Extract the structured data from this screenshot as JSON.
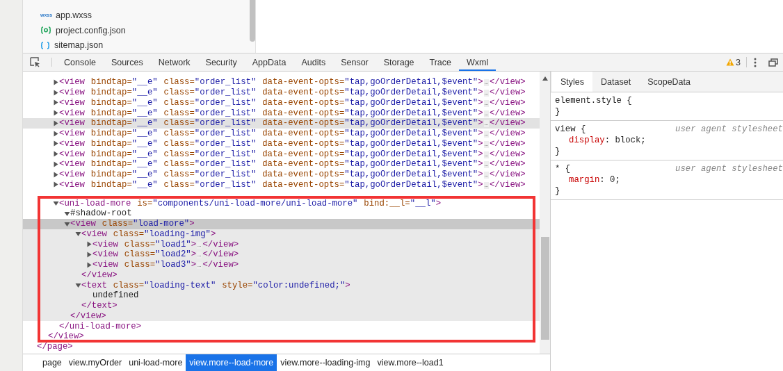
{
  "file_tree": {
    "items": [
      {
        "name": "app.wxss",
        "kind": "wxss",
        "badge": "wxss"
      },
      {
        "name": "project.config.json",
        "kind": "config"
      },
      {
        "name": "sitemap.json",
        "kind": "json"
      }
    ]
  },
  "toolbar": {
    "tabs": [
      {
        "label": "Console",
        "selected": false
      },
      {
        "label": "Sources",
        "selected": false
      },
      {
        "label": "Network",
        "selected": false
      },
      {
        "label": "Security",
        "selected": false
      },
      {
        "label": "AppData",
        "selected": false
      },
      {
        "label": "Audits",
        "selected": false
      },
      {
        "label": "Sensor",
        "selected": false
      },
      {
        "label": "Storage",
        "selected": false
      },
      {
        "label": "Trace",
        "selected": false
      },
      {
        "label": "Wxml",
        "selected": true
      }
    ],
    "warnings": "3"
  },
  "elements": {
    "tree": [
      {
        "close": "</page>",
        "children": [
          {
            "close": "</view>",
            "children": [
              {
                "open": {
                  "tag": "<view",
                  "attrs": [
                    {
                      "name": "bindtap=",
                      "value": "\"__e\""
                    },
                    {
                      "name": "class=",
                      "value": "\"order_list\""
                    },
                    {
                      "name": "data-event-opts=",
                      "value": "\"tap,goOrderDetail,$event\""
                    }
                  ],
                  "end": ">"
                },
                "expanded": false,
                "hovered": false,
                "ellipsis": "…",
                "close": "</view>"
              },
              {
                "open": {
                  "tag": "<view",
                  "attrs": [
                    {
                      "name": "bindtap=",
                      "value": "\"__e\""
                    },
                    {
                      "name": "class=",
                      "value": "\"order_list\""
                    },
                    {
                      "name": "data-event-opts=",
                      "value": "\"tap,goOrderDetail,$event\""
                    }
                  ],
                  "end": ">"
                },
                "expanded": false,
                "hovered": false,
                "ellipsis": "…",
                "close": "</view>"
              },
              {
                "open": {
                  "tag": "<view",
                  "attrs": [
                    {
                      "name": "bindtap=",
                      "value": "\"__e\""
                    },
                    {
                      "name": "class=",
                      "value": "\"order_list\""
                    },
                    {
                      "name": "data-event-opts=",
                      "value": "\"tap,goOrderDetail,$event\""
                    }
                  ],
                  "end": ">"
                },
                "expanded": false,
                "hovered": false,
                "ellipsis": "…",
                "close": "</view>"
              },
              {
                "open": {
                  "tag": "<view",
                  "attrs": [
                    {
                      "name": "bindtap=",
                      "value": "\"__e\""
                    },
                    {
                      "name": "class=",
                      "value": "\"order_list\""
                    },
                    {
                      "name": "data-event-opts=",
                      "value": "\"tap,goOrderDetail,$event\""
                    }
                  ],
                  "end": ">"
                },
                "expanded": false,
                "hovered": false,
                "ellipsis": "…",
                "close": "</view>"
              },
              {
                "open": {
                  "tag": "<view",
                  "attrs": [
                    {
                      "name": "bindtap=",
                      "value": "\"__e\""
                    },
                    {
                      "name": "class=",
                      "value": "\"order_list\""
                    },
                    {
                      "name": "data-event-opts=",
                      "value": "\"tap,goOrderDetail,$event\""
                    }
                  ],
                  "end": ">"
                },
                "expanded": false,
                "hovered": true,
                "ellipsis": "…",
                "close": "</view>"
              },
              {
                "open": {
                  "tag": "<view",
                  "attrs": [
                    {
                      "name": "bindtap=",
                      "value": "\"__e\""
                    },
                    {
                      "name": "class=",
                      "value": "\"order_list\""
                    },
                    {
                      "name": "data-event-opts=",
                      "value": "\"tap,goOrderDetail,$event\""
                    }
                  ],
                  "end": ">"
                },
                "expanded": false,
                "hovered": false,
                "ellipsis": "…",
                "close": "</view>"
              },
              {
                "open": {
                  "tag": "<view",
                  "attrs": [
                    {
                      "name": "bindtap=",
                      "value": "\"__e\""
                    },
                    {
                      "name": "class=",
                      "value": "\"order_list\""
                    },
                    {
                      "name": "data-event-opts=",
                      "value": "\"tap,goOrderDetail,$event\""
                    }
                  ],
                  "end": ">"
                },
                "expanded": false,
                "hovered": false,
                "ellipsis": "…",
                "close": "</view>"
              },
              {
                "open": {
                  "tag": "<view",
                  "attrs": [
                    {
                      "name": "bindtap=",
                      "value": "\"__e\""
                    },
                    {
                      "name": "class=",
                      "value": "\"order_list\""
                    },
                    {
                      "name": "data-event-opts=",
                      "value": "\"tap,goOrderDetail,$event\""
                    }
                  ],
                  "end": ">"
                },
                "expanded": false,
                "hovered": false,
                "ellipsis": "…",
                "close": "</view>"
              },
              {
                "open": {
                  "tag": "<view",
                  "attrs": [
                    {
                      "name": "bindtap=",
                      "value": "\"__e\""
                    },
                    {
                      "name": "class=",
                      "value": "\"order_list\""
                    },
                    {
                      "name": "data-event-opts=",
                      "value": "\"tap,goOrderDetail,$event\""
                    }
                  ],
                  "end": ">"
                },
                "expanded": false,
                "hovered": false,
                "ellipsis": "…",
                "close": "</view>"
              },
              {
                "open": {
                  "tag": "<view",
                  "attrs": [
                    {
                      "name": "bindtap=",
                      "value": "\"__e\""
                    },
                    {
                      "name": "class=",
                      "value": "\"order_list\""
                    },
                    {
                      "name": "data-event-opts=",
                      "value": "\"tap,goOrderDetail,$event\""
                    }
                  ],
                  "end": ">"
                },
                "expanded": false,
                "hovered": false,
                "ellipsis": "…",
                "close": "</view>"
              },
              {
                "open": {
                  "tag": "<view",
                  "attrs": [
                    {
                      "name": "bindtap=",
                      "value": "\"__e\""
                    },
                    {
                      "name": "class=",
                      "value": "\"order_list\""
                    },
                    {
                      "name": "data-event-opts=",
                      "value": "\"tap,goOrderDetail,$event\""
                    }
                  ],
                  "end": ">"
                },
                "expanded": false,
                "hovered": false,
                "ellipsis": "…",
                "close": "</view>"
              },
              {
                "open": {
                  "tag": "<uni-load-more",
                  "attrs": [
                    {
                      "name": "is=",
                      "value": "\"components/uni-load-more/uni-load-more\""
                    },
                    {
                      "name": "bind:__l=",
                      "value": "\"__l\""
                    }
                  ],
                  "end": ">"
                },
                "expanded": true,
                "close": "</uni-load-more>",
                "children": [
                  {
                    "label": "#shadow-root",
                    "expanded": true
                  },
                  {
                    "open": {
                      "tag": "<view",
                      "attrs": [
                        {
                          "name": "class=",
                          "value": "\"load-more\""
                        }
                      ],
                      "end": ">"
                    },
                    "expanded": true,
                    "selected": true,
                    "close": "</view>",
                    "children": [
                      {
                        "open": {
                          "tag": "<view",
                          "attrs": [
                            {
                              "name": "class=",
                              "value": "\"loading-img\""
                            }
                          ],
                          "end": ">"
                        },
                        "expanded": true,
                        "close": "</view>",
                        "children": [
                          {
                            "open": {
                              "tag": "<view",
                              "attrs": [
                                {
                                  "name": "class=",
                                  "value": "\"load1\""
                                }
                              ],
                              "end": ">"
                            },
                            "expanded": false,
                            "ellipsis": "…",
                            "close": "</view>"
                          },
                          {
                            "open": {
                              "tag": "<view",
                              "attrs": [
                                {
                                  "name": "class=",
                                  "value": "\"load2\""
                                }
                              ],
                              "end": ">"
                            },
                            "expanded": false,
                            "ellipsis": "…",
                            "close": "</view>"
                          },
                          {
                            "open": {
                              "tag": "<view",
                              "attrs": [
                                {
                                  "name": "class=",
                                  "value": "\"load3\""
                                }
                              ],
                              "end": ">"
                            },
                            "expanded": false,
                            "ellipsis": "…",
                            "close": "</view>"
                          }
                        ]
                      },
                      {
                        "open": {
                          "tag": "<text",
                          "attrs": [
                            {
                              "name": "class=",
                              "value": "\"loading-text\""
                            },
                            {
                              "name": "style=",
                              "value": "\"color:undefined;\""
                            }
                          ],
                          "end": ">"
                        },
                        "expanded": true,
                        "close": "</text>",
                        "children": [
                          {
                            "text": "undefined"
                          }
                        ]
                      }
                    ]
                  }
                ]
              }
            ]
          }
        ]
      }
    ]
  },
  "styles_panel": {
    "tabs": [
      {
        "label": "Styles",
        "selected": true
      },
      {
        "label": "Dataset",
        "selected": false
      },
      {
        "label": "ScopeData",
        "selected": false
      }
    ],
    "rules": [
      {
        "selector": "element.style {",
        "close": "}"
      },
      {
        "selector": "view {",
        "source": "user agent stylesheet",
        "declarations": [
          {
            "property": "display",
            "value": ": block;"
          }
        ],
        "close": "}"
      },
      {
        "selector": "* {",
        "source": "user agent stylesheet",
        "declarations": [
          {
            "property": "margin",
            "value": ": 0;"
          }
        ],
        "close": "}"
      }
    ]
  },
  "breadcrumbs": [
    {
      "label": "page",
      "selected": false
    },
    {
      "label": "view.myOrder",
      "selected": false
    },
    {
      "label": "uni-load-more",
      "selected": false
    },
    {
      "label": "view.more--load-more",
      "selected": true
    },
    {
      "label": "view.more--loading-img",
      "selected": false
    },
    {
      "label": "view.more--load1",
      "selected": false
    }
  ]
}
